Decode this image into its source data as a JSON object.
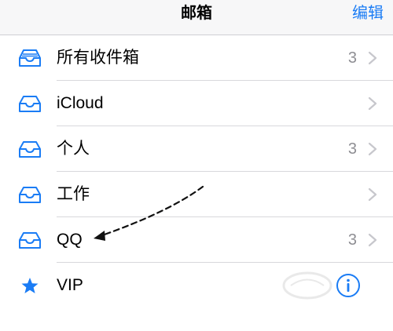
{
  "navbar": {
    "title": "邮箱",
    "edit_label": "编辑"
  },
  "mailboxes": [
    {
      "label": "所有收件箱",
      "count": "3",
      "icon": "inbox-stack-icon"
    },
    {
      "label": "iCloud",
      "count": "",
      "icon": "inbox-tray-icon"
    },
    {
      "label": "个人",
      "count": "3",
      "icon": "inbox-tray-icon"
    },
    {
      "label": "工作",
      "count": "",
      "icon": "inbox-tray-icon"
    },
    {
      "label": "QQ",
      "count": "3",
      "icon": "inbox-tray-icon"
    },
    {
      "label": "VIP",
      "count": "",
      "icon": "star-icon"
    }
  ],
  "colors": {
    "accent": "#1a7cf5",
    "count_gray": "#8e8e93",
    "chevron_gray": "#c7c7cc",
    "separator": "#d8d8dc",
    "navbar_bg": "#f7f7f8"
  }
}
